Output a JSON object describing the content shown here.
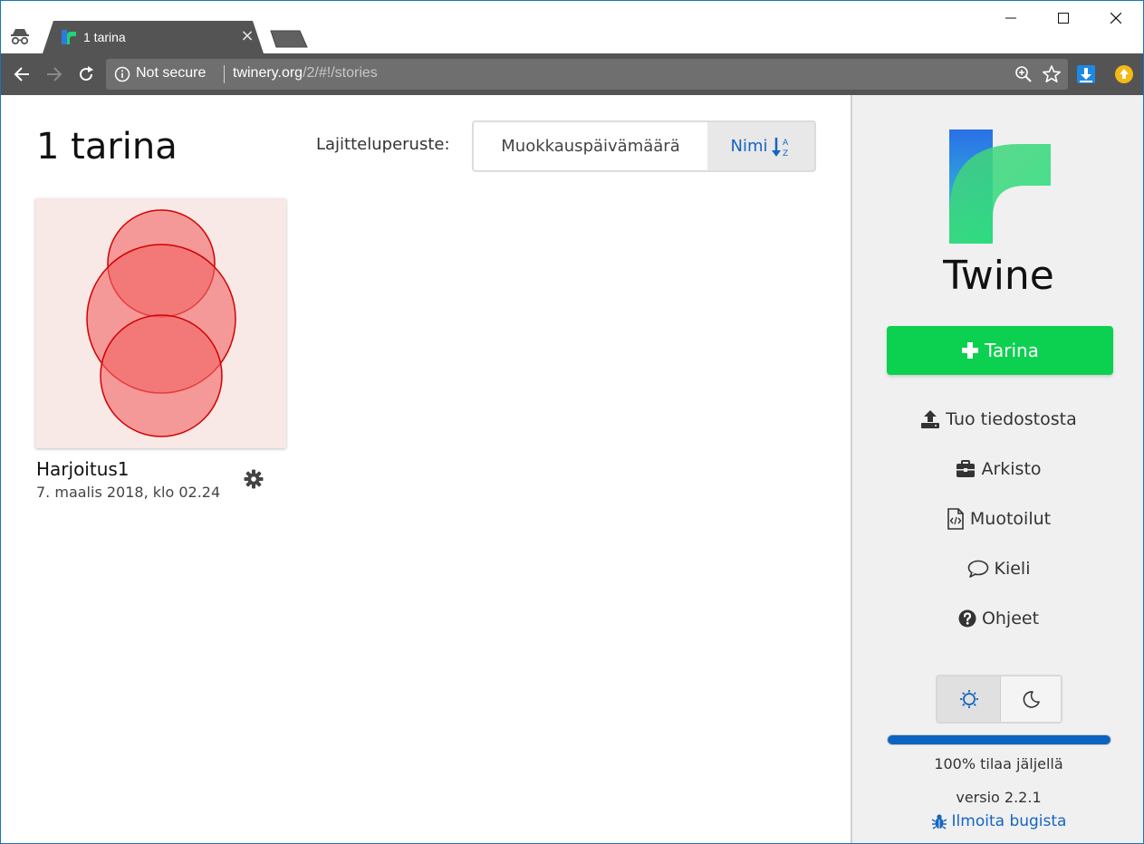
{
  "browser": {
    "tab_title": "1 tarina",
    "tab_close": "×",
    "security_label": "Not secure",
    "url_host": "twinery.org",
    "url_path": "/2/#!/stories"
  },
  "main": {
    "title": "1 tarina",
    "sort_label": "Lajitteluperuste:",
    "sort_options": [
      {
        "label": "Muokkauspäivämäärä",
        "selected": false
      },
      {
        "label": "Nimi",
        "selected": true,
        "icon": "sort-alpha-asc-icon"
      }
    ],
    "stories": [
      {
        "name": "Harjoitus1",
        "date": "7. maalis 2018, klo 02.24",
        "preview_colors": {
          "background": "#f8e8e6",
          "fill": "#f26464",
          "stroke": "#d40000"
        }
      }
    ]
  },
  "sidebar": {
    "app_name": "Twine",
    "new_story_label": "Tarina",
    "links": [
      {
        "label": "Tuo tiedostosta",
        "icon": "upload-icon"
      },
      {
        "label": "Arkisto",
        "icon": "briefcase-icon"
      },
      {
        "label": "Muotoilut",
        "icon": "code-file-icon"
      },
      {
        "label": "Kieli",
        "icon": "speech-bubble-icon"
      },
      {
        "label": "Ohjeet",
        "icon": "question-circle-icon"
      }
    ],
    "theme": {
      "active": "light"
    },
    "storage_fraction": 1.0,
    "storage_text": "100% tilaa jäljellä",
    "version_text": "versio 2.2.1",
    "bug_report_label": "Ilmoita bugista"
  },
  "colors": {
    "accent": "#0cd04f",
    "link": "#1565c0",
    "toolbar": "#545454",
    "sidebar_bg": "#f0f0f0"
  }
}
